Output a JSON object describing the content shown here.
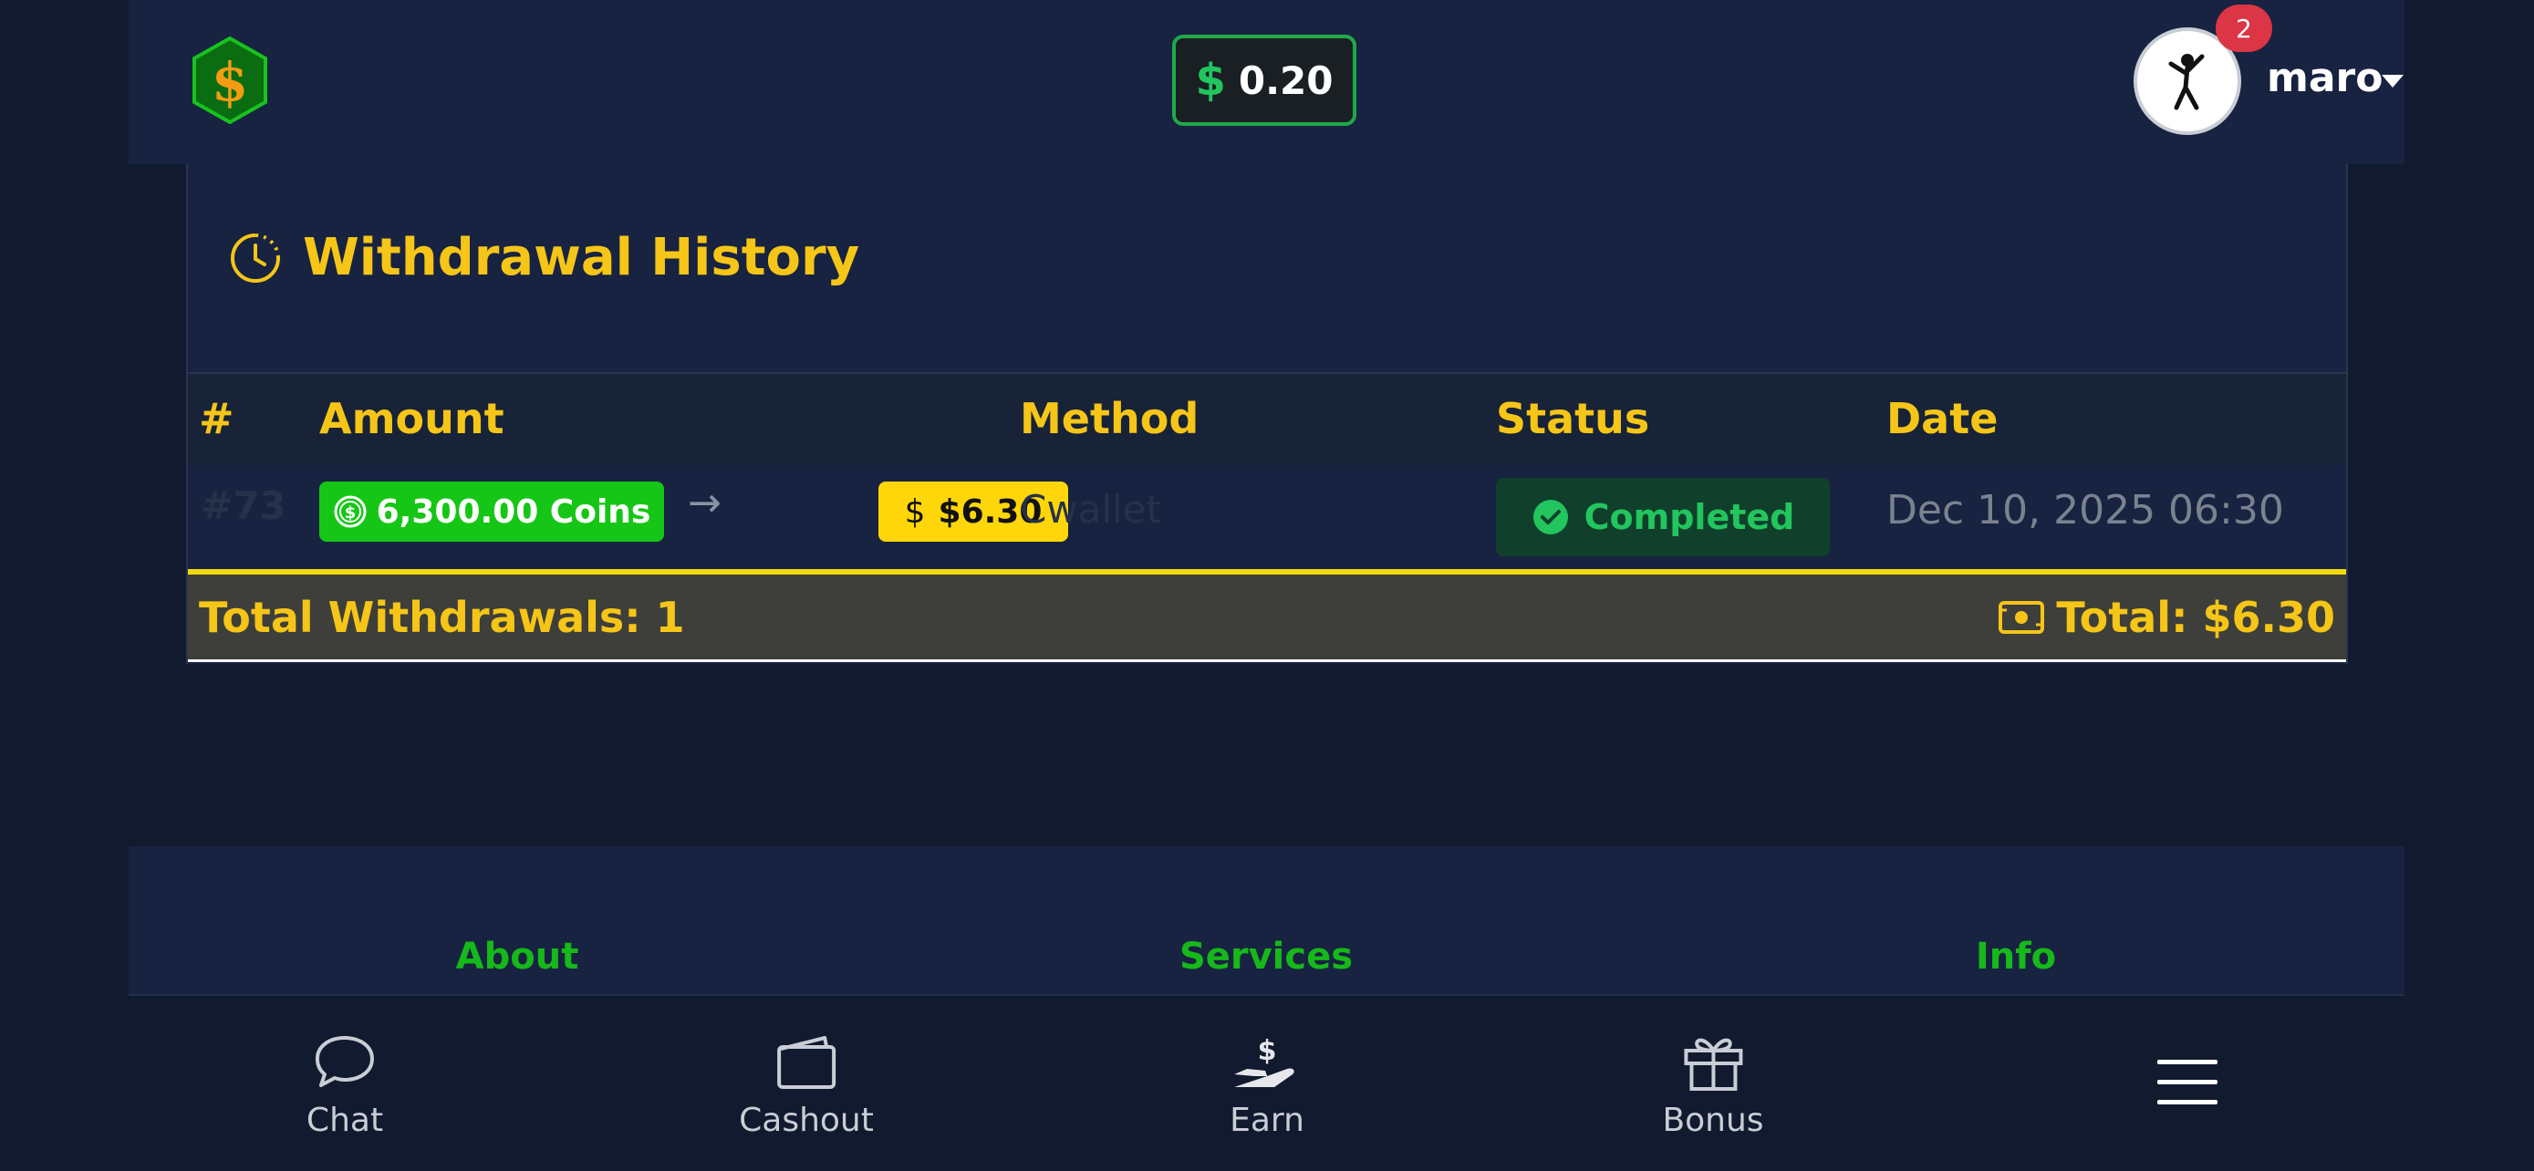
{
  "header": {
    "balance_symbol": "$",
    "balance": "0.20",
    "notification_count": "2",
    "username": "maro"
  },
  "withdrawals": {
    "title": "Withdrawal History",
    "columns": [
      "#",
      "Amount",
      "Method",
      "Status",
      "Date"
    ],
    "rows": [
      {
        "id": "#73",
        "coins": "6,300.00 Coins",
        "arrow": "→",
        "usd_symbol": "$",
        "usd": "$6.30",
        "method": "Cwallet",
        "status": "Completed",
        "date": "Dec 10, 2025 06:30"
      }
    ],
    "total_count_label": "Total Withdrawals: 1",
    "total_amount_label": "Total: $6.30"
  },
  "footer": {
    "links": [
      "About",
      "Services",
      "Info"
    ]
  },
  "bottom_nav": {
    "items": [
      {
        "label": "Chat",
        "icon": "chat-bubble-icon"
      },
      {
        "label": "Cashout",
        "icon": "wallet-icon"
      },
      {
        "label": "Earn",
        "icon": "hand-dollar-icon"
      },
      {
        "label": "Bonus",
        "icon": "gift-icon"
      },
      {
        "label": "",
        "icon": "hamburger-menu-icon"
      }
    ]
  },
  "colors": {
    "accent_yellow": "#f5c518",
    "success_green": "#22c55e",
    "coins_green": "#16c616",
    "background": "#111a2e",
    "panel": "#172340"
  }
}
